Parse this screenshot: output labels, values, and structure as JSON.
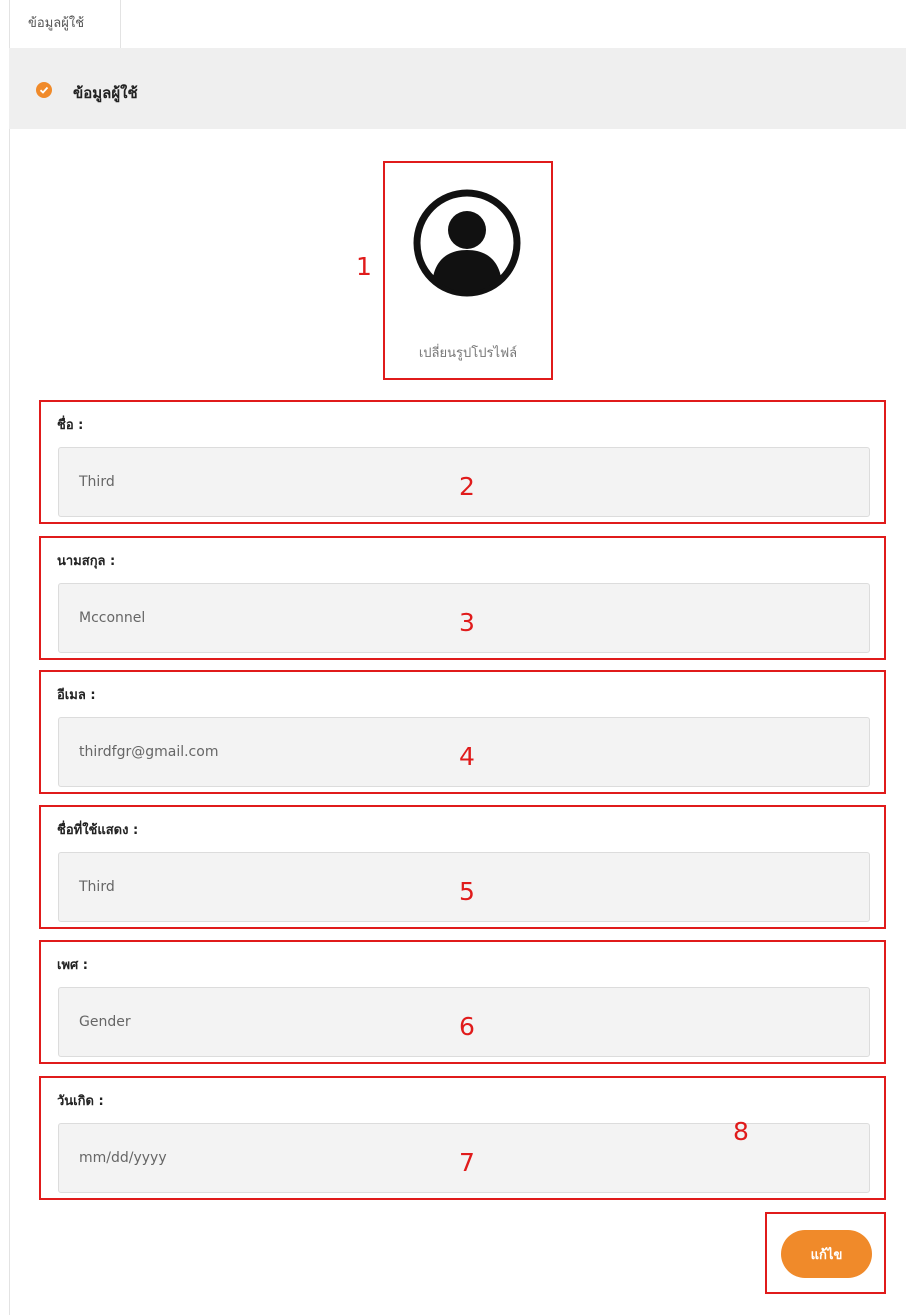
{
  "tabs": [
    {
      "label": "ข้อมูลผู้ใช้"
    }
  ],
  "section": {
    "title": "ข้อมูลผู้ใช้",
    "icon": "check-circle-icon",
    "accent": "#f08a2a"
  },
  "avatar": {
    "icon": "user-avatar-icon",
    "change_label": "เปลี่ยนรูปโปรไฟล์"
  },
  "fields": [
    {
      "label": "ชื่อ :",
      "value": "Third"
    },
    {
      "label": "นามสกุล :",
      "value": "Mcconnel"
    },
    {
      "label": "อีเมล :",
      "value": "thirdfgr@gmail.com"
    },
    {
      "label": "ชื่อที่ใช้แสดง :",
      "value": "Third"
    },
    {
      "label": "เพศ :",
      "value": "Gender"
    },
    {
      "label": "วันเกิด :",
      "value": "mm/dd/yyyy"
    }
  ],
  "edit_button": {
    "label": "แก้ไข"
  },
  "annotations": [
    "1",
    "2",
    "3",
    "4",
    "5",
    "6",
    "7",
    "8"
  ],
  "annotation_color": "#e01b1b"
}
